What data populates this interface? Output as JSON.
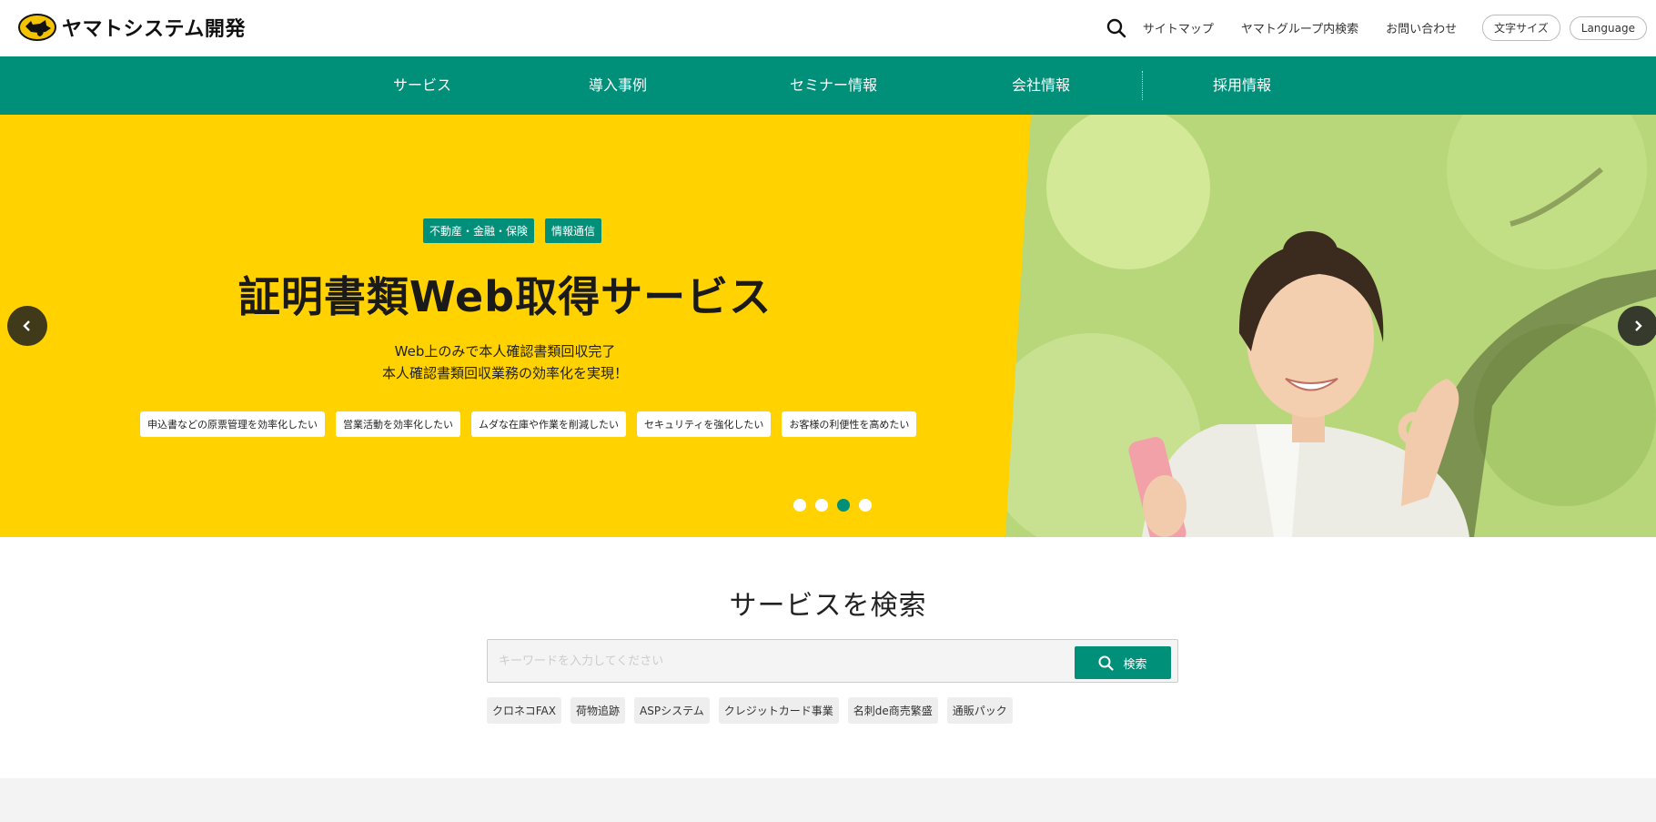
{
  "header": {
    "logo_text": "ヤマトシステム開発",
    "links": [
      "サイトマップ",
      "ヤマトグループ内検索",
      "お問い合わせ"
    ],
    "font_size_label": "文字サイズ",
    "language_label": "Language"
  },
  "nav": {
    "items": [
      "サービス",
      "導入事例",
      "セミナー情報",
      "会社情報",
      "採用情報"
    ]
  },
  "hero": {
    "tags": [
      "不動産・金融・保険",
      "情報通信"
    ],
    "title": "証明書類Web取得サービス",
    "subtitle_line1": "Web上のみで本人確認書類回収完了",
    "subtitle_line2": "本人確認書類回収業務の効率化を実現！",
    "chips": [
      "申込書などの原票管理を効率化したい",
      "営業活動を効率化したい",
      "ムダな在庫や作業を削減したい",
      "セキュリティを強化したい",
      "お客様の利便性を高めたい"
    ],
    "slides_count": 4,
    "active_slide": 3
  },
  "search": {
    "title": "サービスを検索",
    "placeholder": "キーワードを入力してください",
    "button_label": "検索",
    "keywords": [
      "クロネコFAX",
      "荷物追跡",
      "ASPシステム",
      "クレジットカード事業",
      "名刺de商売繁盛",
      "通販パック"
    ]
  },
  "colors": {
    "brand_green": "#00907a",
    "hero_yellow": "#ffd200"
  }
}
